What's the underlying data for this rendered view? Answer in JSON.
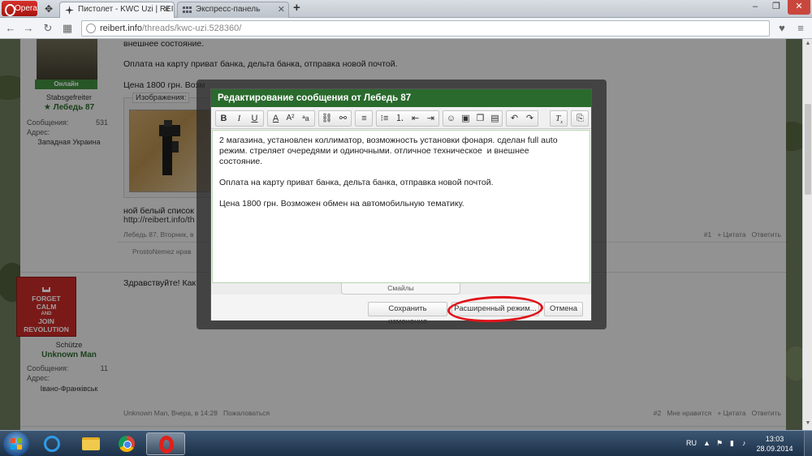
{
  "browser": {
    "menu_label": "Opera",
    "tabs": [
      {
        "label": "Пистолет - KWC Uzi | REIB"
      },
      {
        "label": "Экспресс-панель"
      }
    ],
    "address": {
      "host": "reibert.info",
      "path": "/threads/kwc-uzi.528360/"
    }
  },
  "posts": [
    {
      "status": "Онлайн",
      "rank": "Stabsgefreiter",
      "username": "Лебедь 87",
      "stats": [
        {
          "label": "Сообщения:",
          "value": "531"
        },
        {
          "label": "Адрес:",
          "value": ""
        }
      ],
      "location": "Западная Украина",
      "text_lines": [
        "внешнее состояние.",
        "Оплата на карту приват банка, дельта банка, отправка новой почтой.",
        "Цена 1800 грн. Возм"
      ],
      "attachments_label": "Изображения:",
      "extra_lines": [
        "ной белый список",
        "http://reibert.info/th"
      ],
      "footer_left": "Лебедь 87, Вторник, в",
      "footer_right": [
        "#1",
        "+ Цитата",
        "Ответить"
      ],
      "likes": "ProstoNemez нрав"
    },
    {
      "poster_lines": [
        "FORGET",
        "CALM",
        "AND",
        "JOIN",
        "REVOLUTION"
      ],
      "rank": "Schütze",
      "username": "Unknown Man",
      "stats": [
        {
          "label": "Сообщения:",
          "value": "11"
        },
        {
          "label": "Адрес:",
          "value": ""
        }
      ],
      "location": "Івано-Франківськ",
      "text": "Здравствуйте! Как",
      "footer_left": "Unknown Man, Вчера, в 14:28",
      "footer_report": "Пожаловаться",
      "footer_right": [
        "#2",
        "Мне нравится",
        "+ Цитата",
        "Ответить"
      ]
    }
  ],
  "modal": {
    "title": "Редактирование сообщения от Лебедь 87",
    "editor_lines": [
      "2 магазина, установлен коллиматор, возможность установки фонаря. сделан full auto",
      "режим. стреляет очередями и одиночными. отличное техническое  и внешнее",
      "состояние.",
      "",
      "Оплата на карту приват банка, дельта банка, отправка новой почтой.",
      "",
      "Цена 1800 грн. Возможен обмен на автомобильную тематику."
    ],
    "smilies_label": "Смайлы",
    "buttons": {
      "save": "Сохранить изменения",
      "advanced": "Расширенный режим...",
      "cancel": "Отмена"
    }
  },
  "taskbar": {
    "lang": "RU",
    "time": "13:03",
    "date": "28.09.2014"
  },
  "colors": {
    "modal_header": "#2a6a2d",
    "online_badge": "#3f8b3f",
    "highlight": "#e0141a"
  }
}
